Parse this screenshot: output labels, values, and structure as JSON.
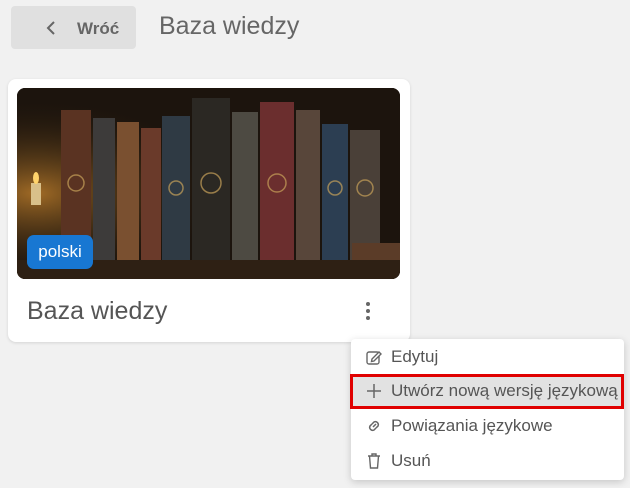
{
  "header": {
    "back_label": "Wróć",
    "title": "Baza wiedzy"
  },
  "card": {
    "language_badge": "polski",
    "title": "Baza wiedzy"
  },
  "menu": {
    "items": [
      {
        "label": "Edytuj",
        "icon": "pencil-icon"
      },
      {
        "label": "Utwórz nową wersję językową",
        "icon": "plus-icon",
        "highlighted": true
      },
      {
        "label": "Powiązania językowe",
        "icon": "link-icon"
      },
      {
        "label": "Usuń",
        "icon": "trash-icon"
      }
    ]
  },
  "colors": {
    "badge": "#1877d2",
    "highlight_border": "#e00000"
  }
}
